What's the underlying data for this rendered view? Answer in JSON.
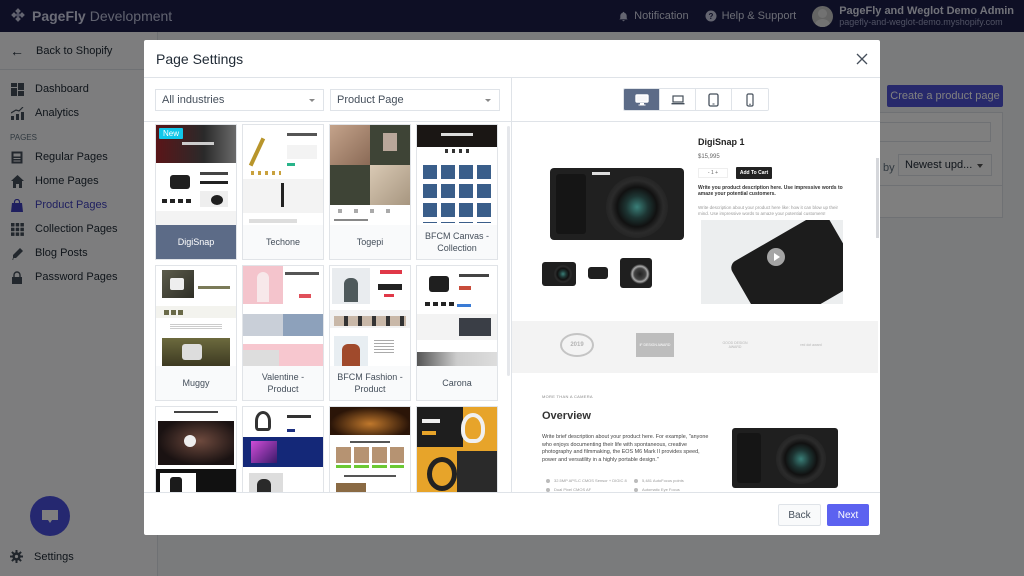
{
  "topbar": {
    "brand_name": "PageFly",
    "brand_env": "Development",
    "notification_label": "Notification",
    "help_label": "Help & Support",
    "user_name": "PageFly and Weglot Demo Admin",
    "user_store": "pagefly-and-weglot-demo.myshopify.com"
  },
  "sidebar": {
    "back_label": "Back to Shopify",
    "items_top": [
      {
        "label": "Dashboard",
        "icon": "dashboard-icon"
      },
      {
        "label": "Analytics",
        "icon": "analytics-icon"
      }
    ],
    "section_label": "PAGES",
    "add_symbol": "+",
    "items_pages": [
      {
        "label": "Regular Pages",
        "icon": "document-icon",
        "active": false
      },
      {
        "label": "Home Pages",
        "icon": "home-icon",
        "active": false
      },
      {
        "label": "Product Pages",
        "icon": "shopping-bag-icon",
        "active": true
      },
      {
        "label": "Collection Pages",
        "icon": "grid-icon",
        "active": false
      },
      {
        "label": "Blog Posts",
        "icon": "pencil-icon",
        "active": false
      },
      {
        "label": "Password Pages",
        "icon": "lock-icon",
        "active": false
      }
    ],
    "settings_label": "Settings"
  },
  "main": {
    "create_button": "Create a product page",
    "sort_label": "by",
    "sort_value": "Newest upd..."
  },
  "modal": {
    "title": "Page Settings",
    "industry_select": "All industries",
    "page_type_select": "Product Page",
    "templates": [
      {
        "name": "DigiSnap",
        "badge": "New",
        "selected": true
      },
      {
        "name": "Techone",
        "badge": "",
        "selected": false
      },
      {
        "name": "Togepi",
        "badge": "",
        "selected": false
      },
      {
        "name": "BFCM Canvas - Collection",
        "badge": "",
        "selected": false
      },
      {
        "name": "Muggy",
        "badge": "",
        "selected": false
      },
      {
        "name": "Valentine - Product",
        "badge": "",
        "selected": false
      },
      {
        "name": "BFCM Fashion - Product",
        "badge": "",
        "selected": false
      },
      {
        "name": "Carona",
        "badge": "",
        "selected": false
      },
      {
        "name": "",
        "badge": "",
        "selected": false
      },
      {
        "name": "",
        "badge": "",
        "selected": false
      },
      {
        "name": "",
        "badge": "",
        "selected": false
      },
      {
        "name": "",
        "badge": "",
        "selected": false
      }
    ],
    "devices": [
      {
        "name": "desktop",
        "active": true
      },
      {
        "name": "laptop",
        "active": false
      },
      {
        "name": "tablet",
        "active": false
      },
      {
        "name": "mobile",
        "active": false
      }
    ],
    "preview": {
      "product_title": "DigiSnap 1",
      "price": "$15,995",
      "qty": "-   1   +",
      "add_to_cart": "Add To Cart",
      "desc_bold": "Write you product description here. Use impressive words to amaze your potential customers.",
      "desc": "Write description about your product here like: how it can blow up their mind. Use impressive words to amaze your potential customers!",
      "awards": [
        "2019",
        "iF DESIGN AWARD",
        "GOOD DESIGN AWARD",
        "red dot award"
      ],
      "kicker": "MORE THAN A CAMERA",
      "overview_title": "Overview",
      "overview_text": "Write brief description about your product here. For example, \"anyone who enjoys documenting their life with spontaneous, creative photography and filmmaking, the EOS M6 Mark II provides speed, power and versatility in a highly portable design.\"",
      "specs": [
        "32.5MP APS-C CMOS Sensor + DIGIC 8",
        "5,481 AutoFocus points",
        "Dual Pixel CMOS AF",
        "Automatic Eye Focus"
      ]
    },
    "back_button": "Back",
    "next_button": "Next"
  }
}
